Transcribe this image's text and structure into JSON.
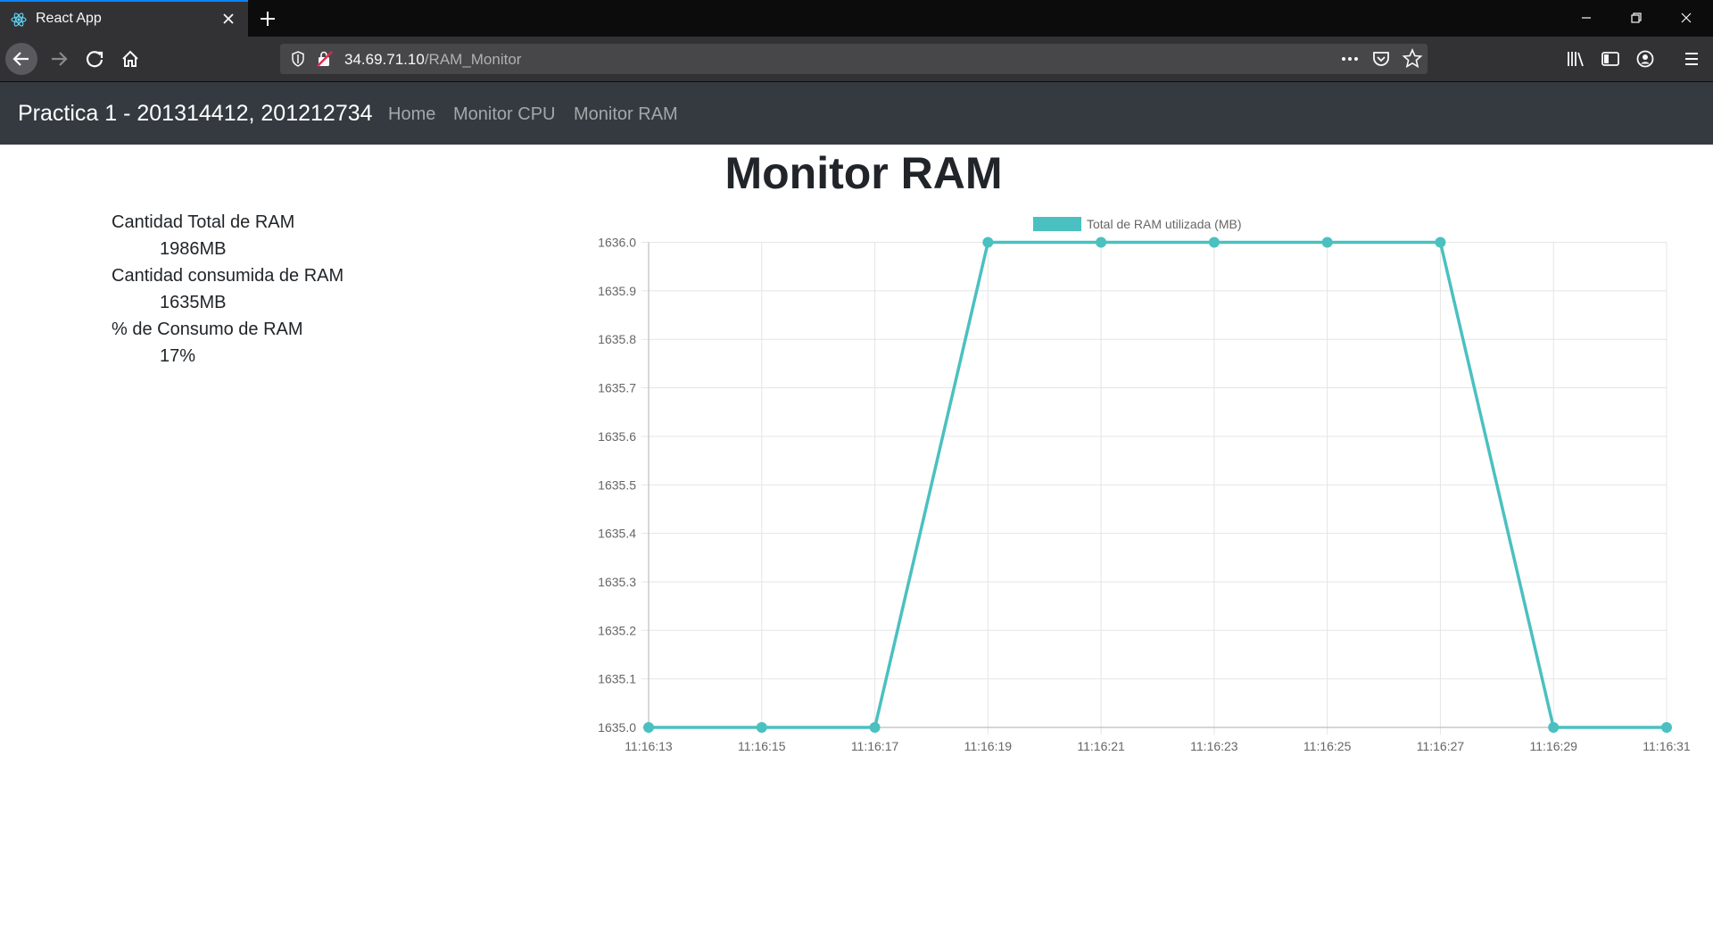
{
  "browser": {
    "tab_title": "React App",
    "url_host": "34.69.71.10",
    "url_path": "/RAM_Monitor"
  },
  "app": {
    "brand": "Practica 1 - 201314412, 201212734",
    "nav": [
      "Home",
      "Monitor CPU",
      "Monitor RAM"
    ]
  },
  "page": {
    "title": "Monitor RAM",
    "stats": [
      {
        "label": "Cantidad Total de RAM",
        "value": "1986MB"
      },
      {
        "label": "Cantidad consumida de RAM",
        "value": "1635MB"
      },
      {
        "label": "% de Consumo de RAM",
        "value": "17%"
      }
    ]
  },
  "colors": {
    "series": "#4bc0c0",
    "grid": "#e5e5e5",
    "axis_text": "#666666"
  },
  "chart_data": {
    "type": "line",
    "categories": [
      "11:16:13",
      "11:16:15",
      "11:16:17",
      "11:16:19",
      "11:16:21",
      "11:16:23",
      "11:16:25",
      "11:16:27",
      "11:16:29",
      "11:16:31"
    ],
    "series": [
      {
        "name": "Total de RAM utilizada (MB)",
        "values": [
          1635,
          1635,
          1635,
          1636,
          1636,
          1636,
          1636,
          1636,
          1635,
          1635
        ]
      }
    ],
    "ylim": [
      1635.0,
      1636.0
    ],
    "yticks": [
      "1636.0",
      "1635.9",
      "1635.8",
      "1635.7",
      "1635.6",
      "1635.5",
      "1635.4",
      "1635.3",
      "1635.2",
      "1635.1",
      "1635.0"
    ],
    "grid": true,
    "legend": "top"
  }
}
